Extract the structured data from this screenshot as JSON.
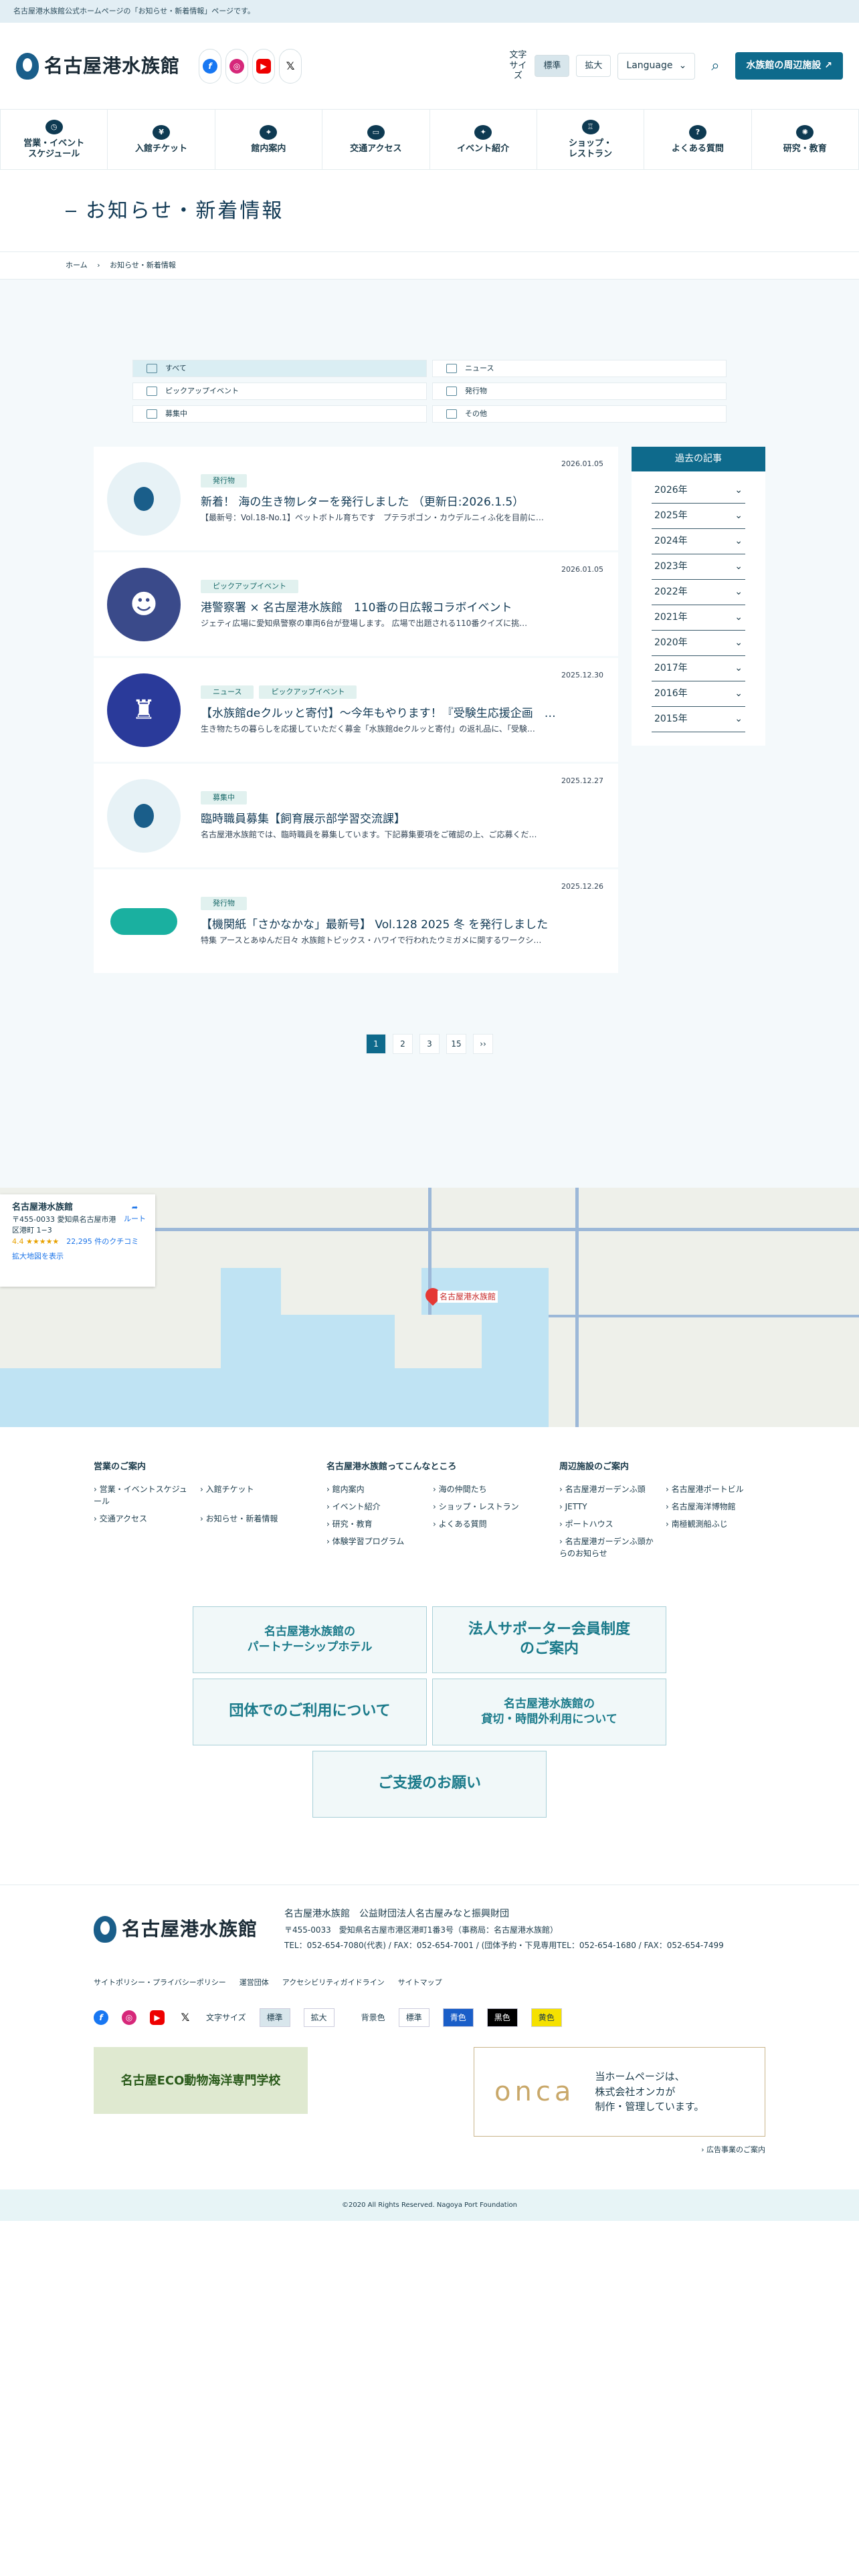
{
  "topbar": "名古屋港水族館公式ホームページの「お知らせ・新着情報」ページです。",
  "header": {
    "logo_text": "名古屋港水族館",
    "font_size_label": "文字サイズ",
    "fs_standard": "標準",
    "fs_large": "拡大",
    "language": "Language",
    "nearby": "水族館の周辺施設"
  },
  "nav": [
    {
      "label": "営業・イベント\nスケジュール",
      "icon": "clock-icon",
      "g": "◷"
    },
    {
      "label": "入館チケット",
      "icon": "yen-icon",
      "g": "¥"
    },
    {
      "label": "館内案内",
      "icon": "map-icon",
      "g": "⌖"
    },
    {
      "label": "交通アクセス",
      "icon": "bus-icon",
      "g": "▭"
    },
    {
      "label": "イベント紹介",
      "icon": "ticket-icon",
      "g": "✦"
    },
    {
      "label": "ショップ・\nレストラン",
      "icon": "shop-icon",
      "g": "♖"
    },
    {
      "label": "よくある質問",
      "icon": "question-icon",
      "g": "?"
    },
    {
      "label": "研究・教育",
      "icon": "research-icon",
      "g": "✺"
    }
  ],
  "page_title": "お知らせ・新着情報",
  "breadcrumb": {
    "home": "ホーム",
    "current": "お知らせ・新着情報"
  },
  "filters": [
    {
      "label": "すべて",
      "active": true
    },
    {
      "label": "ニュース"
    },
    {
      "label": "ピックアップイベント"
    },
    {
      "label": "発行物"
    },
    {
      "label": "募集中"
    },
    {
      "label": "その他"
    }
  ],
  "news": [
    {
      "tags": [
        "発行物"
      ],
      "date": "2026.01.05",
      "title": "新着！ 海の生き物レターを発行しました （更新日:2026.1.5）",
      "text": "【最新号：Vol.18-No.1】ペットボトル育ちです　プテラポゴン・カウデルニィふ化を目前に…",
      "thumb": "logo"
    },
    {
      "tags": [
        "ピックアップイベント"
      ],
      "date": "2026.01.05",
      "title": "港警察署 × 名古屋港水族館　110番の日広報コラボイベント",
      "text": "ジェティ広場に愛知県警察の車両6台が登場します。 広場で出題される110番クイズに挑…",
      "thumb": "photo1"
    },
    {
      "tags": [
        "ニュース",
        "ピックアップイベント"
      ],
      "date": "2025.12.30",
      "title": "【水族館deクルッと寄付】～今年もやります！『受験生応援企画　…",
      "text": "生き物たちの暮らしを応援していただく募金「水族館deクルッと寄付」の返礼品に、「受験…",
      "thumb": "photo2"
    },
    {
      "tags": [
        "募集中"
      ],
      "date": "2025.12.27",
      "title": "臨時職員募集【飼育展示部学習交流課】",
      "text": "名古屋港水族館では、臨時職員を募集しています。下記募集要項をご確認の上、ご応募くだ…",
      "thumb": "logo"
    },
    {
      "tags": [
        "発行物"
      ],
      "date": "2025.12.26",
      "title": "【機関紙「さかなかな」最新号】 Vol.128 2025 冬 を発行しました",
      "text": "特集 アースとあゆんだ日々 水族館トピックス・ハワイで行われたウミガメに関するワークシ…",
      "thumb": "sakana"
    }
  ],
  "side": {
    "head": "過去の記事",
    "years": [
      "2026年",
      "2025年",
      "2024年",
      "2023年",
      "2022年",
      "2021年",
      "2020年",
      "2017年",
      "2016年",
      "2015年"
    ]
  },
  "pager": [
    "1",
    "2",
    "3",
    "15",
    "››"
  ],
  "map": {
    "name": "名古屋港水族館",
    "addr": "〒455-0033 愛知県名古屋市港区港町 1−3",
    "rating": "4.4 ★★★★★",
    "reviews": "22,295 件のクチコミ",
    "route": "ルート",
    "enlarge": "拡大地図を表示",
    "pin": "名古屋港水族館"
  },
  "footer_cols": [
    {
      "title": "営業のご案内",
      "items": [
        "営業・イベントスケジュール",
        "入館チケット",
        "交通アクセス",
        "お知らせ・新着情報"
      ]
    },
    {
      "title": "名古屋港水族館ってこんなところ",
      "items": [
        "館内案内",
        "海の仲間たち",
        "イベント紹介",
        "ショップ・レストラン",
        "研究・教育",
        "よくある質問",
        "体験学習プログラム"
      ]
    },
    {
      "title": "周辺施設のご案内",
      "items": [
        "名古屋港ガーデンふ頭",
        "名古屋港ポートビル",
        "JETTY",
        "名古屋海洋博物館",
        "ポートハウス",
        "南極観測船ふじ",
        "名古屋港ガーデンふ頭からのお知らせ"
      ]
    }
  ],
  "banners": [
    "名古屋港水族館の\nパートナーシップホテル",
    "法人サポーター会員制度\nのご案内",
    "団体でのご利用について",
    "名古屋港水族館の\n貸切・時間外利用について",
    "ご支援のお願い"
  ],
  "foot": {
    "org": "名古屋港水族館　公益財団法人名古屋みなと振興財団",
    "addr": "〒455-0033　愛知県名古屋市港区港町1番3号（事務局：名古屋港水族館）",
    "tel": "TEL：052-654-7080(代表) / FAX：052-654-7001 / (団体予約・下見専用TEL：052-654-1680 / FAX：052-654-7499",
    "policy": [
      "サイトポリシー・プライバシーポリシー",
      "運営団体",
      "アクセシビリティガイドライン",
      "サイトマップ"
    ],
    "fs": "文字サイズ",
    "bg": "背景色",
    "std": "標準",
    "lg": "拡大",
    "blue": "青色",
    "black": "黒色",
    "yellow": "黄色",
    "ad1": "名古屋ECO動物海洋専門学校",
    "ad2_logo": "onca",
    "ad2_text": "当ホームページは、\n株式会社オンカが\n制作・管理しています。",
    "adlink": "広告事業のご案内",
    "copy": "©2020 All Rights Reserved. Nagoya Port Foundation"
  }
}
